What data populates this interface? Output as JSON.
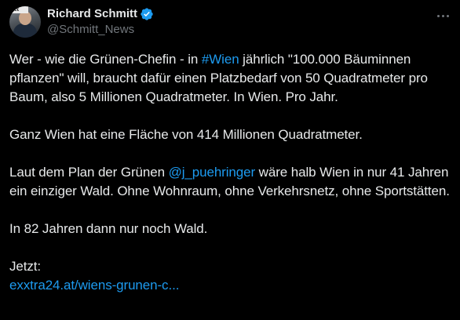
{
  "author": {
    "display_name": "Richard Schmitt",
    "handle": "@Schmitt_News",
    "avatar_tag": "exx",
    "verified": true
  },
  "tweet": {
    "p1_before": "Wer - wie die Grünen-Chefin - in ",
    "p1_hashtag": "#Wien",
    "p1_after": " jährlich \"100.000 Bäuminnen pflanzen\" will, braucht dafür einen Platzbedarf von 50 Quadratmeter pro Baum, also 5 Millionen Quadratmeter. In Wien. Pro Jahr.",
    "p2": "Ganz Wien hat eine Fläche von 414 Millionen Quadratmeter.",
    "p3_before": "Laut dem Plan der Grünen ",
    "p3_mention": "@j_puehringer",
    "p3_after": " wäre halb Wien in nur 41 Jahren ein einziger Wald. Ohne Wohnraum, ohne Verkehrsnetz, ohne Sportstätten.",
    "p4": "In 82 Jahren dann nur noch Wald.",
    "p5": "Jetzt:",
    "p5_link": "exxtra24.at/wiens-grunen-c..."
  },
  "colors": {
    "background": "#000000",
    "text": "#e7e9ea",
    "secondary": "#71767b",
    "accent": "#1d9bf0"
  },
  "icons": {
    "verified": "verified-badge-icon",
    "more": "more-options-icon"
  }
}
